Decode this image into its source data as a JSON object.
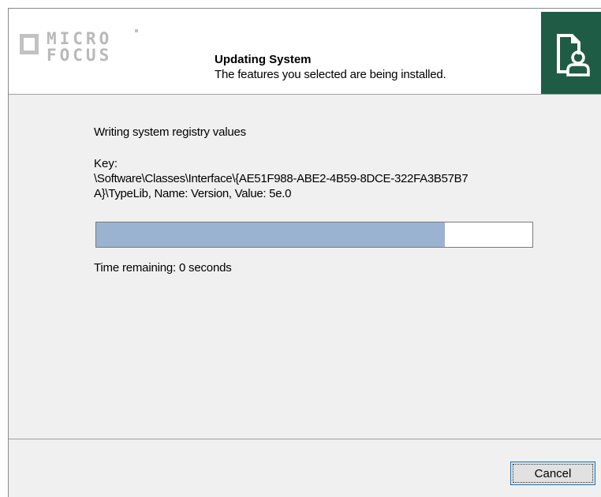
{
  "header": {
    "logo_line1": "MICRO",
    "logo_line2": "FOCUS",
    "title": "Updating System",
    "subtitle": "The features you selected are being installed.",
    "icon": "installer-icon"
  },
  "main": {
    "status_text": "Writing system registry values",
    "key_label": "Key:",
    "key_line1": "\\Software\\Classes\\Interface\\{AE51F988-ABE2-4B59-8DCE-322FA3B57B7",
    "key_line2": "A}\\TypeLib, Name: Version, Value: 5e.0",
    "progress": 0.8,
    "time_remaining": "Time remaining: 0 seconds"
  },
  "footer": {
    "cancel_label": "Cancel"
  },
  "colors": {
    "accent": "#1f5c46",
    "progress_fill": "#9ab3d1",
    "focus_border": "#0078d7"
  }
}
